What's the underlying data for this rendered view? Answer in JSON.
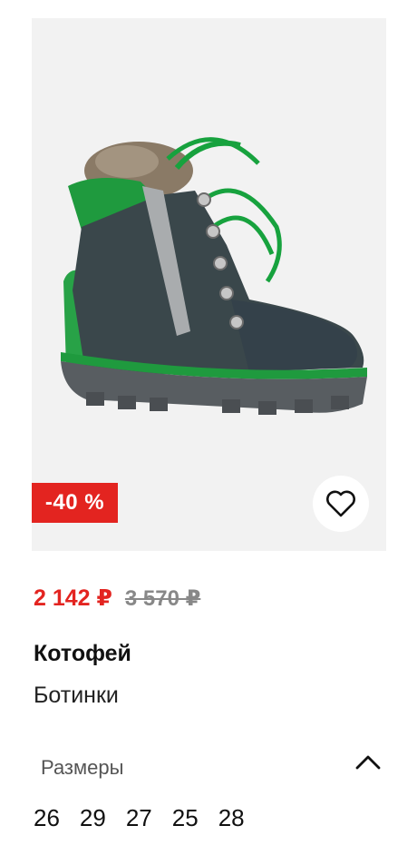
{
  "product": {
    "discount_badge": "-40 %",
    "price_new": "2 142 ₽",
    "price_old": "3 570 ₽",
    "brand": "Котофей",
    "type": "Ботинки"
  },
  "sizes": {
    "label": "Размеры",
    "values": [
      "26",
      "29",
      "27",
      "25",
      "28"
    ]
  },
  "icons": {
    "favorite": "heart-icon",
    "collapse": "chevron-up-icon"
  },
  "colors": {
    "discount": "#e32420",
    "boot_green": "#1f9a3e",
    "boot_body": "#3a474b"
  }
}
